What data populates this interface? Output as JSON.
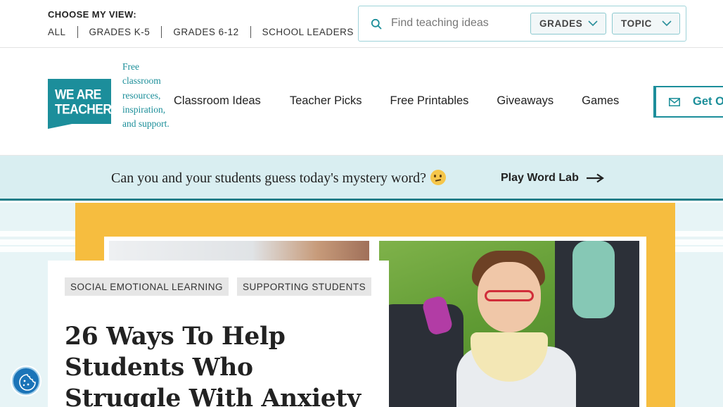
{
  "topbar": {
    "view_label": "CHOOSE MY VIEW:",
    "view_links": [
      "ALL",
      "GRADES K-5",
      "GRADES 6-12",
      "SCHOOL LEADERS"
    ],
    "search": {
      "placeholder": "Find teaching ideas",
      "value": ""
    },
    "filters": {
      "grades": "GRADES",
      "topic": "TOPIC"
    }
  },
  "header": {
    "logo_text_line1": "WE ARE",
    "logo_text_line2": "TEACHERS",
    "tagline": "Free classroom resources, inspiration, and support.",
    "nav": [
      "Classroom Ideas",
      "Teacher Picks",
      "Free Printables",
      "Giveaways",
      "Games"
    ],
    "cta_label": "Get Ou"
  },
  "promo": {
    "text": "Can you and your students guess today's mystery word?",
    "link_label": "Play Word Lab"
  },
  "article": {
    "tags": [
      "SOCIAL EMOTIONAL LEARNING",
      "SUPPORTING STUDENTS"
    ],
    "title": "26 Ways To Help Students Who Struggle With Anxiety"
  },
  "colors": {
    "brand_teal": "#1c8e9b",
    "promo_bg": "#d9eef1",
    "hero_yellow": "#f6bd3f",
    "a11y_blue": "#1b74b8"
  },
  "icons": [
    "search-icon",
    "chevron-down-icon",
    "mail-icon",
    "arrow-right-icon",
    "accessibility-icon"
  ]
}
